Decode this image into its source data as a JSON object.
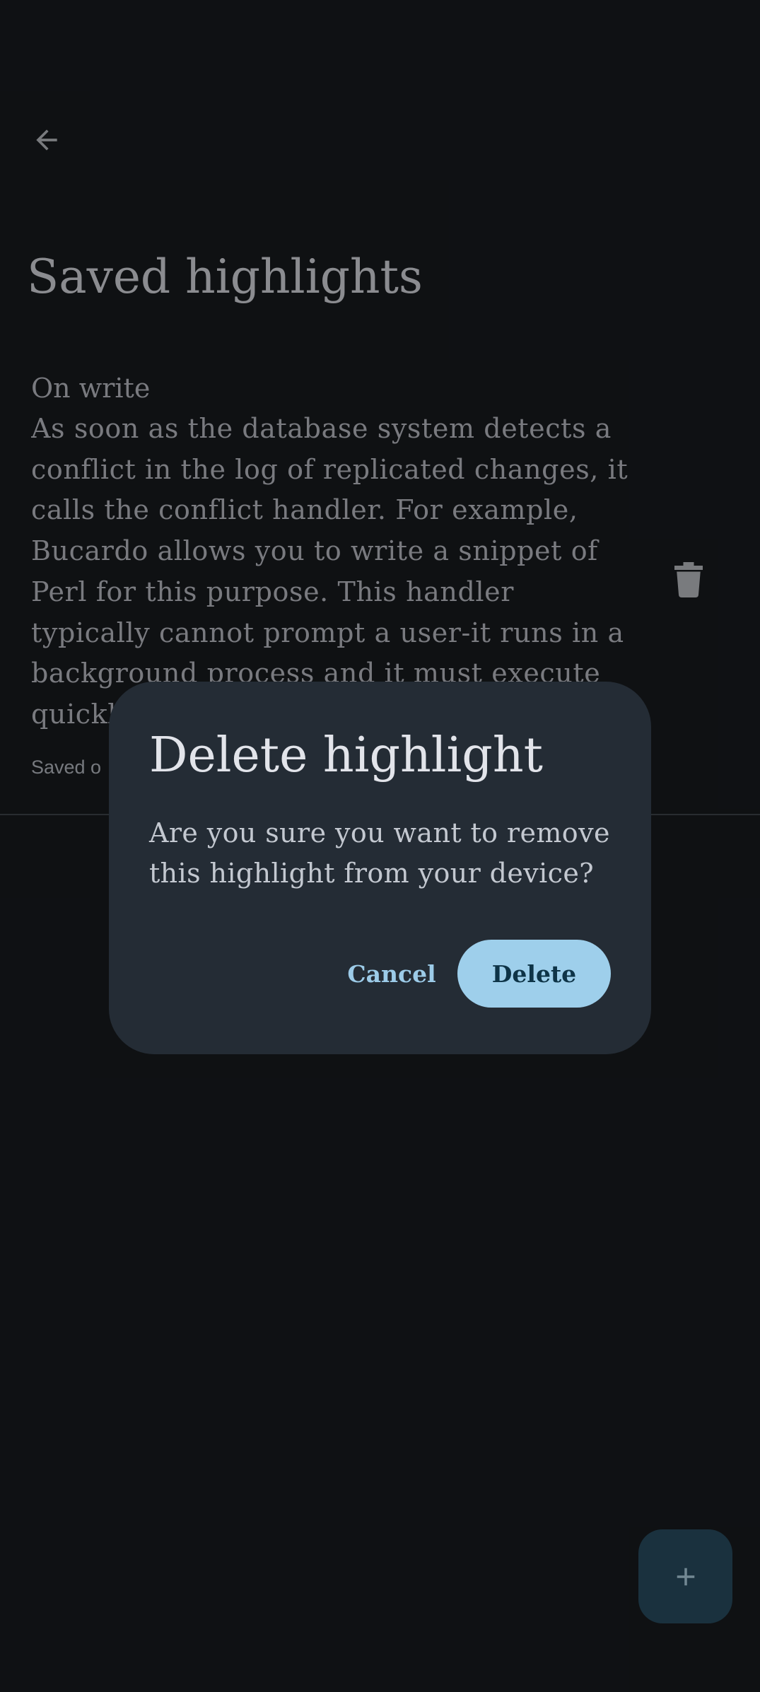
{
  "header": {
    "back_icon": "arrow-back-icon",
    "title": "Saved highlights"
  },
  "highlights": [
    {
      "heading": "On write",
      "text": "As soon as the database system detects a conflict in the log of replicated changes, it calls the conflict handler. For example, Bucardo allows you to write a snippet of Perl for this purpose. This handler typically cannot prompt a user-it runs in a background process and it must execute quickly",
      "saved_label": "Saved o",
      "delete_icon": "trash-icon"
    }
  ],
  "fab": {
    "icon": "plus-icon"
  },
  "dialog": {
    "title": "Delete highlight",
    "body": "Are you sure you want to remove this highlight from your device?",
    "cancel_label": "Cancel",
    "confirm_label": "Delete"
  },
  "colors": {
    "background": "#191c20",
    "dialog_surface": "#242c35",
    "primary": "#9ecfeb",
    "on_primary": "#0e3447",
    "fab_container": "#2a5064"
  }
}
